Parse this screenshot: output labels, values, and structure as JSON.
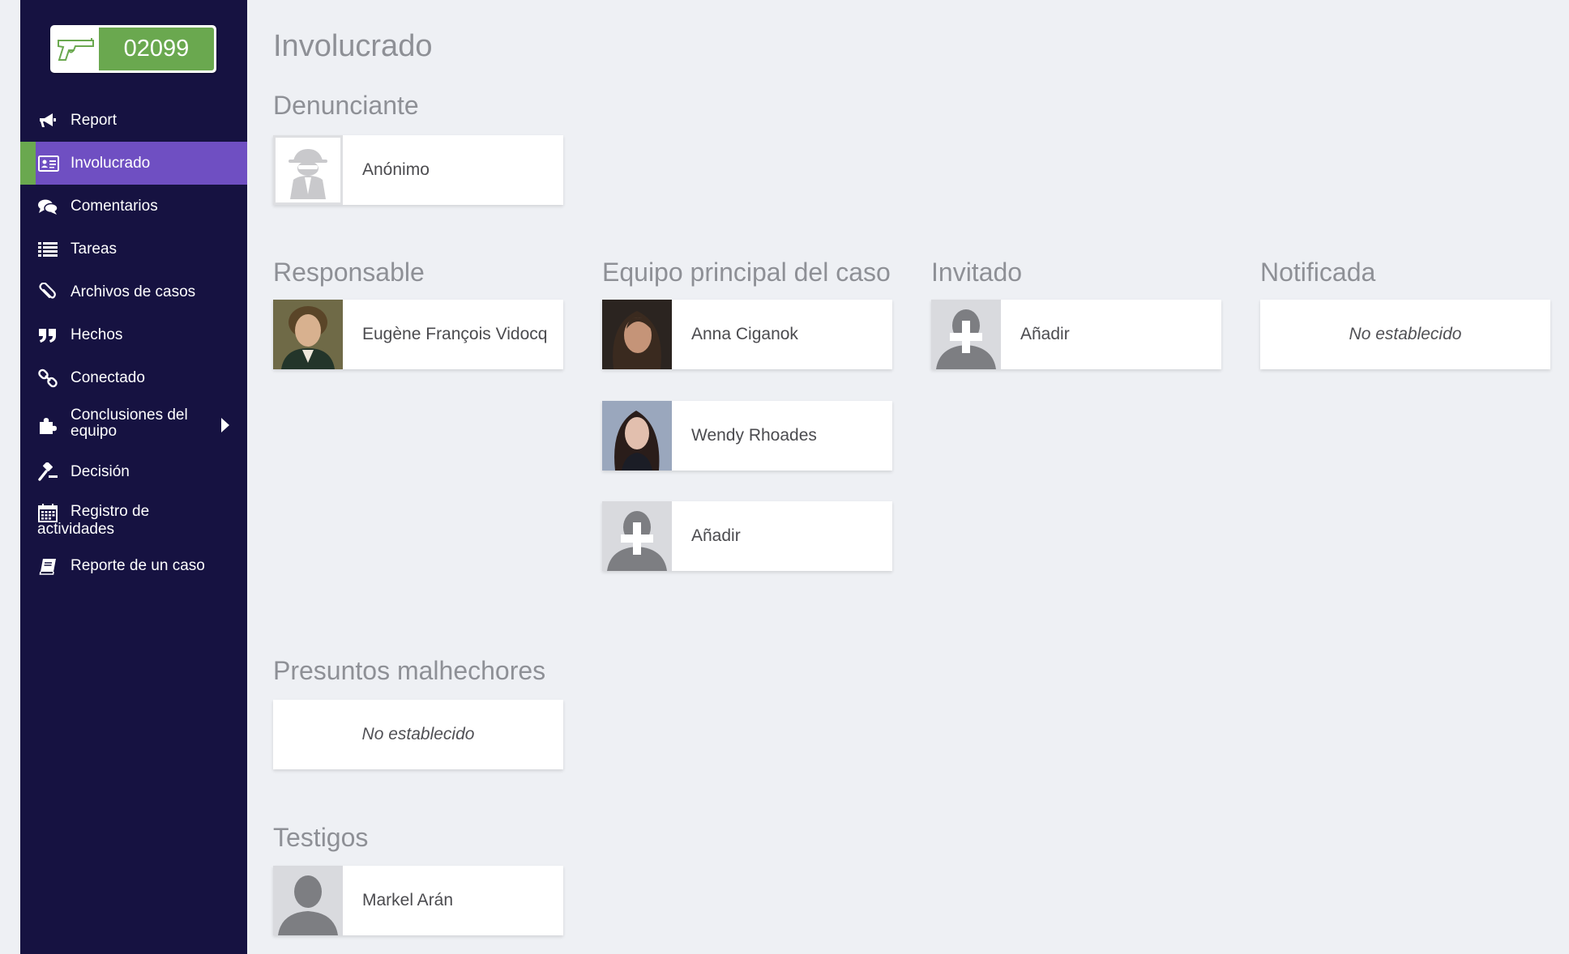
{
  "case": {
    "number": "02099"
  },
  "sidebar": {
    "items": [
      {
        "label": "Report",
        "icon": "megaphone-icon"
      },
      {
        "label": "Involucrado",
        "icon": "id-card-icon",
        "active": true
      },
      {
        "label": "Comentarios",
        "icon": "comments-icon"
      },
      {
        "label": "Tareas",
        "icon": "list-icon"
      },
      {
        "label": "Archivos de casos",
        "icon": "paperclip-icon"
      },
      {
        "label": "Hechos",
        "icon": "quote-icon"
      },
      {
        "label": "Conectado",
        "icon": "link-icon"
      },
      {
        "label": "Conclusiones del equipo",
        "icon": "puzzle-icon"
      },
      {
        "label": "Decisión",
        "icon": "gavel-icon"
      },
      {
        "label": "Registro de actividades",
        "icon": "calendar-icon"
      },
      {
        "label": "Reporte de un caso",
        "icon": "book-icon"
      }
    ]
  },
  "main": {
    "title": "Involucrado",
    "sections": {
      "denunciante": {
        "title": "Denunciante",
        "people": [
          "Anónimo"
        ]
      },
      "responsable": {
        "title": "Responsable",
        "people": [
          "Eugène François Vidocq"
        ]
      },
      "equipo": {
        "title": "Equipo principal del caso",
        "people": [
          "Anna Ciganok",
          "Wendy Rhoades"
        ],
        "add_label": "Añadir"
      },
      "invitado": {
        "title": "Invitado",
        "add_label": "Añadir"
      },
      "notificada": {
        "title": "Notificada",
        "empty_label": "No establecido"
      },
      "malhechores": {
        "title": "Presuntos malhechores",
        "empty_label": "No establecido"
      },
      "testigos": {
        "title": "Testigos",
        "people": [
          "Markel Arán"
        ]
      }
    }
  },
  "colors": {
    "sidebar_bg": "#161241",
    "active_item": "#6f4fc2",
    "accent_green": "#6aa84f",
    "page_bg": "#eef0f4",
    "heading_gray": "#8e9096"
  }
}
